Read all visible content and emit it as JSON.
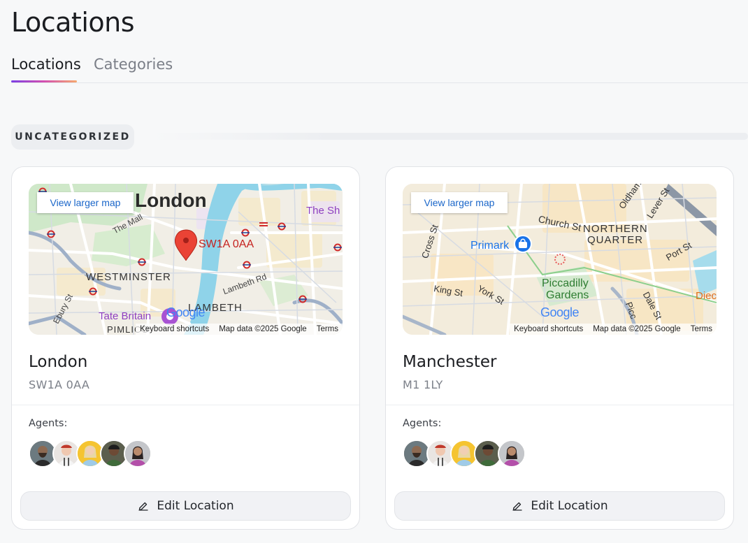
{
  "page": {
    "title": "Locations"
  },
  "tabs": [
    {
      "label": "Locations",
      "active": true
    },
    {
      "label": "Categories",
      "active": false
    }
  ],
  "group": {
    "label": "UNCATEGORIZED"
  },
  "map_controls": {
    "view_larger": "View larger map",
    "keyboard": "Keyboard shortcuts",
    "map_data": "Map data ©2025 Google",
    "terms": "Terms",
    "logo": "Google"
  },
  "locations": [
    {
      "name": "London",
      "postcode": "SW1A 0AA",
      "agents_label": "Agents:",
      "edit_label": "Edit Location",
      "map_labels": {
        "city": "London",
        "marker": "SW1A 0AA",
        "westminster": "WESTMINSTER",
        "lambeth": "LAMBETH",
        "the_mall": "The Mall",
        "lambeth_rd": "Lambeth Rd",
        "tate": "Tate Britain",
        "ebury": "Ebury St",
        "pimlico": "PIMLICO",
        "the_sh": "The Sh"
      }
    },
    {
      "name": "Manchester",
      "postcode": "M1 1LY",
      "agents_label": "Agents:",
      "edit_label": "Edit Location",
      "map_labels": {
        "church": "Church St",
        "northern1": "NORTHERN",
        "northern2": "QUARTER",
        "primark": "Primark",
        "piccadilly1": "Piccadilly",
        "piccadilly2": "Gardens",
        "king": "King St",
        "york": "York St",
        "cross": "Cross St",
        "oldham": "Oldham",
        "lever": "Lever St",
        "port": "Port St",
        "dale": "Dale St",
        "picc": "Picc",
        "diec": "Diec"
      }
    }
  ],
  "colors": {
    "accent_start": "#7b3fe4",
    "accent_end": "#f6a86e",
    "marker": "#ea4335",
    "link": "#1a66c9"
  }
}
